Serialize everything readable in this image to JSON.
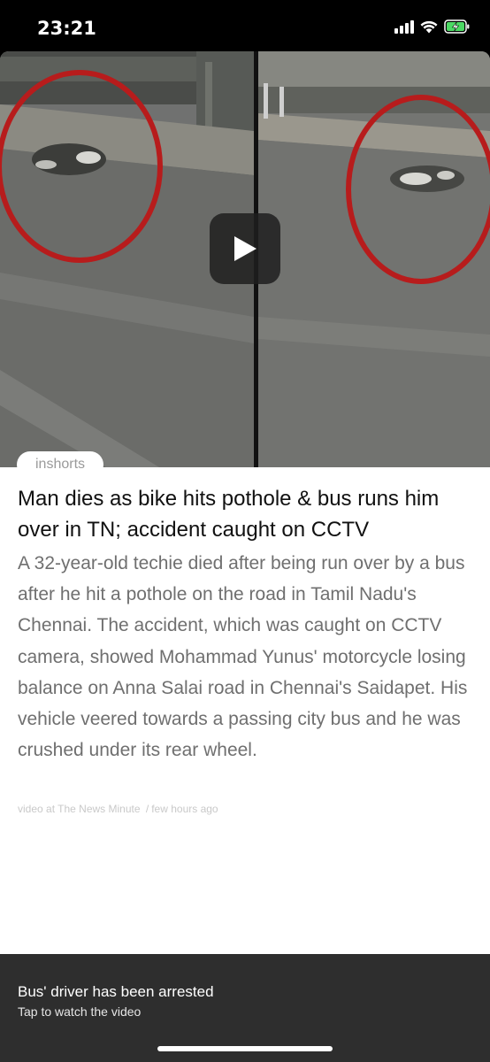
{
  "status_bar": {
    "time": "23:21"
  },
  "article": {
    "source_tag": "inshorts",
    "headline": "Man dies as bike hits pothole & bus runs him over in TN; accident caught on CCTV",
    "body": "A 32-year-old techie died after being run over by a bus after he hit a pothole on the road in Tamil Nadu's Chennai. The accident, which was caught on CCTV camera, showed Mohammad Yunus' motorcycle losing balance on Anna Salai road in Chennai's Saidapet. His vehicle veered towards a passing city bus and he was crushed under its rear wheel.",
    "attribution_prefix": "video at",
    "attribution_source": "The News Minute",
    "attribution_time": "few hours ago"
  },
  "banner": {
    "title": "Bus' driver has been arrested",
    "subtitle": "Tap to watch the video"
  },
  "colors": {
    "highlight_circle": "#b71c1c",
    "banner_background": "#2e2e2e"
  }
}
